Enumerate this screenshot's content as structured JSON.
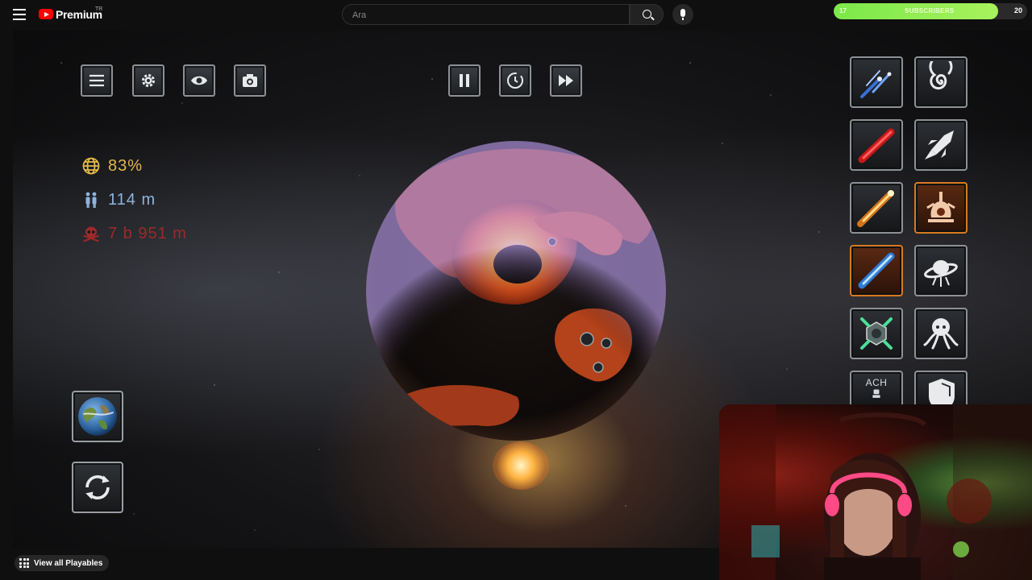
{
  "header": {
    "brand": "Premium",
    "region": "TR",
    "search_placeholder": "Ara"
  },
  "subscriber_goal": {
    "label": "SUBSCRIBERS",
    "current": "17",
    "goal": "20",
    "progress_fraction": 0.85
  },
  "game": {
    "stats": {
      "coverage": "83%",
      "population": "114 m",
      "deaths": "7 b 951 m"
    },
    "toolbar_left": [
      "menu",
      "settings",
      "view",
      "screenshot"
    ],
    "toolbar_center": [
      "pause",
      "time",
      "fast-forward"
    ],
    "weapons": [
      {
        "name": "meteor-shower",
        "active": false
      },
      {
        "name": "black-hole",
        "active": false
      },
      {
        "name": "laser",
        "active": false
      },
      {
        "name": "missile",
        "active": false
      },
      {
        "name": "comet",
        "active": false
      },
      {
        "name": "nuke",
        "active": true
      },
      {
        "name": "ice-laser",
        "active": true
      },
      {
        "name": "ufo",
        "active": false
      },
      {
        "name": "death-star",
        "active": false
      },
      {
        "name": "tentacle-monster",
        "active": false
      },
      {
        "name": "achievements",
        "active": false,
        "label": "ACH"
      },
      {
        "name": "shield",
        "active": false
      }
    ]
  },
  "colors": {
    "accent_orange": "#d9791f",
    "coverage": "#e2b74c",
    "population": "#8fb3dc",
    "deaths": "#9b2a2a",
    "subscriber_fill": "#7be84a"
  },
  "footer": {
    "view_all": "View all Playables"
  }
}
